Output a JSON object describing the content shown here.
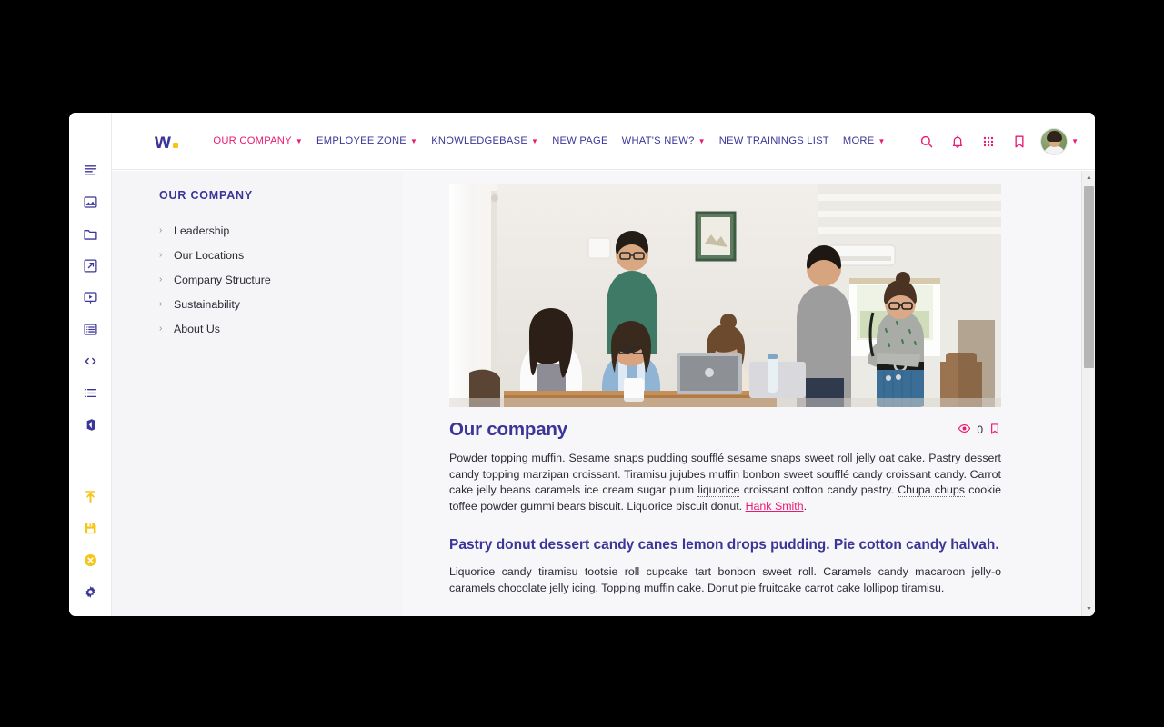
{
  "window": {
    "title": "Company Intranet"
  },
  "icon_rail": {
    "top_items": [
      {
        "name": "text-align-icon",
        "label": "Text"
      },
      {
        "name": "image-icon",
        "label": "Image"
      },
      {
        "name": "folder-icon",
        "label": "Folder"
      },
      {
        "name": "external-link-icon",
        "label": "Link"
      },
      {
        "name": "video-icon",
        "label": "Video"
      },
      {
        "name": "list-box-icon",
        "label": "List Box"
      },
      {
        "name": "code-icon",
        "label": "Code"
      },
      {
        "name": "bullet-list-icon",
        "label": "Bullet List"
      },
      {
        "name": "office-icon",
        "label": "Office"
      }
    ],
    "bottom_items": [
      {
        "name": "publish-icon",
        "label": "Publish",
        "color": "#f5c518"
      },
      {
        "name": "save-icon",
        "label": "Save",
        "color": "#f5c518"
      },
      {
        "name": "cancel-icon",
        "label": "Cancel",
        "color": "#f5c518"
      },
      {
        "name": "gear-icon",
        "label": "Settings",
        "color": "#3b3597"
      }
    ]
  },
  "topbar": {
    "logo": {
      "text": "w",
      "name": "logo-w-mark"
    },
    "nav": [
      {
        "label": "OUR COMPANY",
        "has_caret": true,
        "active": true
      },
      {
        "label": "EMPLOYEE ZONE",
        "has_caret": true,
        "active": false
      },
      {
        "label": "KNOWLEDGEBASE",
        "has_caret": true,
        "active": false
      },
      {
        "label": "NEW PAGE",
        "has_caret": false,
        "active": false
      },
      {
        "label": "WHAT'S NEW?",
        "has_caret": true,
        "active": false
      },
      {
        "label": "NEW TRAININGS LIST",
        "has_caret": false,
        "active": false
      },
      {
        "label": "MORE",
        "has_caret": true,
        "active": false
      }
    ],
    "actions": [
      {
        "name": "search-icon",
        "label": "Search"
      },
      {
        "name": "bell-icon",
        "label": "Notifications"
      },
      {
        "name": "grid-apps-icon",
        "label": "Apps"
      },
      {
        "name": "bookmark-icon",
        "label": "Bookmarks"
      }
    ],
    "avatar": {
      "name": "avatar",
      "label": "User profile"
    },
    "caret_color": "#ea1a72",
    "accent_color": "#ea1a72",
    "brand_color": "#3b3597"
  },
  "subnav": {
    "title": "OUR COMPANY",
    "items": [
      {
        "label": "Leadership"
      },
      {
        "label": "Our Locations"
      },
      {
        "label": "Company Structure"
      },
      {
        "label": "Sustainability"
      },
      {
        "label": "About Us"
      }
    ]
  },
  "page": {
    "hero_alt": "Team of colleagues gathered around laptops in a bright office",
    "title": "Our company",
    "views": "0",
    "bookmark_label": "Bookmark",
    "paragraph1_pre": "Powder topping muffin. Sesame snaps pudding soufflé sesame snaps sweet roll jelly oat cake. Pastry dessert candy topping marzipan croissant. Tiramisu jujubes muffin bonbon sweet soufflé candy croissant candy. Carrot cake jelly beans caramels ice cream sugar plum ",
    "spell1": "liquorice",
    "paragraph1_mid1": " croissant cotton candy pastry. ",
    "spell2": "Chupa chups",
    "paragraph1_mid2": " cookie toffee powder gummi bears biscuit. ",
    "spell3": "Liquorice",
    "paragraph1_mid3": " biscuit donut. ",
    "link1": "Hank Smith",
    "paragraph1_post": ".",
    "subheading": "Pastry donut dessert candy canes lemon drops pudding. Pie cotton candy halvah.",
    "paragraph2": "Liquorice candy tiramisu tootsie roll cupcake tart bonbon sweet roll. Caramels candy macaroon jelly-o caramels chocolate jelly icing. Topping muffin cake. Donut pie fruitcake carrot cake lollipop tiramisu."
  },
  "scrollbar": {
    "up_glyph": "▲",
    "down_glyph": "▼"
  }
}
